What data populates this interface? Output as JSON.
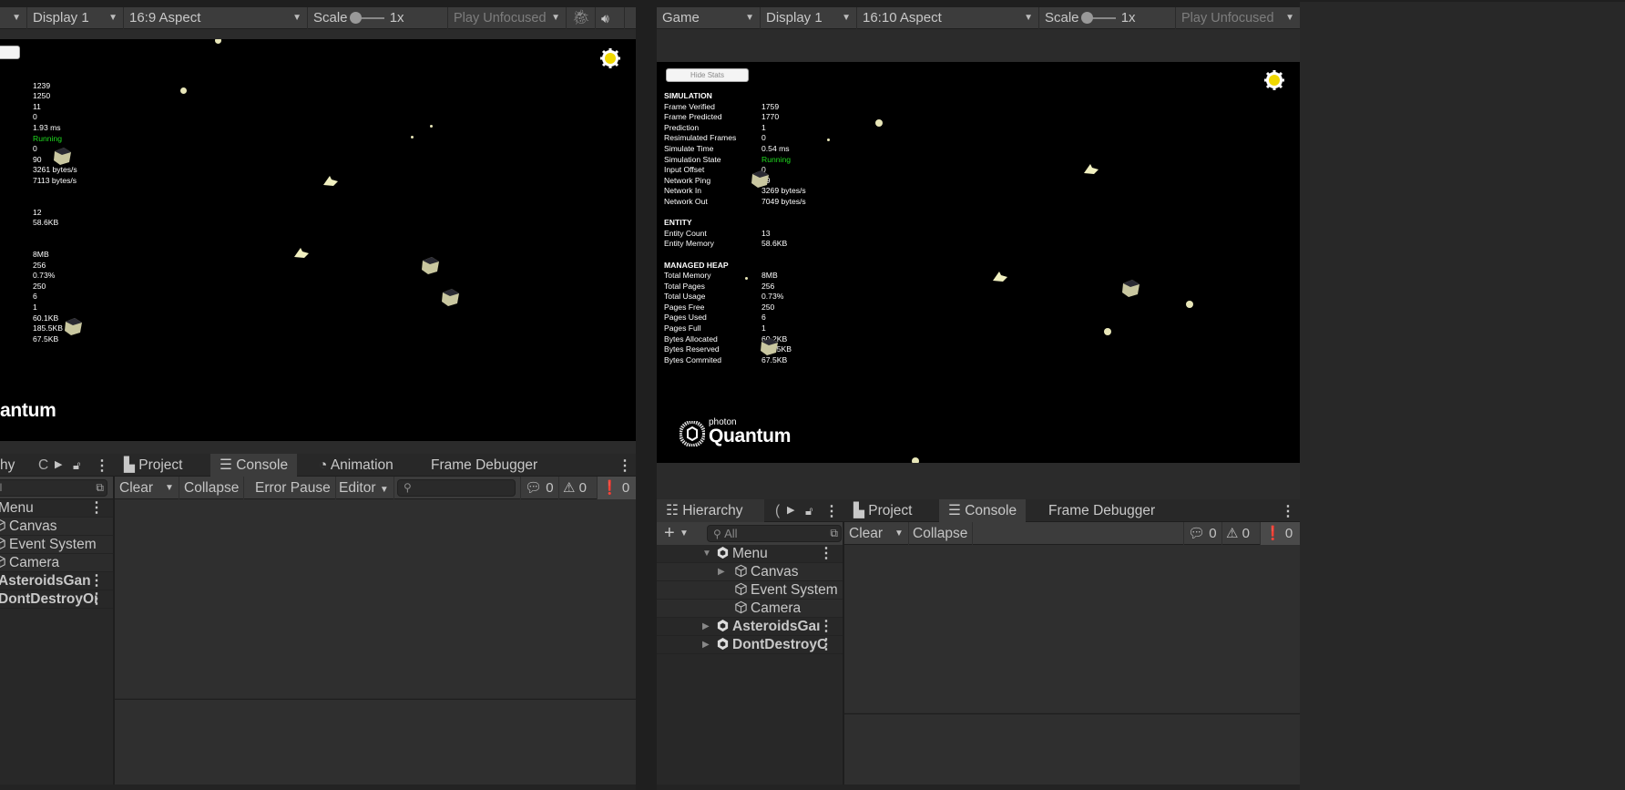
{
  "left_game": {
    "toolbar": {
      "display": "Display 1",
      "aspect": "16:9 Aspect",
      "scale_label": "Scale",
      "scale_value": "1x",
      "play_mode": "Play Unfocused",
      "icons": [
        "chevron-down-icon",
        "bug-icon",
        "audio-icon"
      ]
    },
    "stats": {
      "sections": [
        {
          "rows": [
            {
              "value": "1239"
            },
            {
              "value": "1250"
            },
            {
              "value": "11"
            },
            {
              "value": "0"
            },
            {
              "value": "1.93 ms"
            },
            {
              "value": "Running",
              "status": true
            },
            {
              "value": "0"
            },
            {
              "value": "90"
            },
            {
              "value": "3261 bytes/s"
            },
            {
              "value": "7113 bytes/s"
            }
          ]
        },
        {
          "rows": [
            {
              "value": "12"
            },
            {
              "value": "58.6KB"
            }
          ]
        },
        {
          "rows": [
            {
              "value": "8MB"
            },
            {
              "value": "256"
            },
            {
              "value": "0.73%"
            },
            {
              "value": "250"
            },
            {
              "value": "6"
            },
            {
              "value": "1"
            },
            {
              "value": "60.1KB"
            },
            {
              "value": "185.5KB"
            },
            {
              "value": "67.5KB"
            }
          ]
        }
      ]
    },
    "logo_text": "antum"
  },
  "right_game": {
    "toolbar": {
      "view": "Game",
      "display": "Display 1",
      "aspect": "16:10 Aspect",
      "scale_label": "Scale",
      "scale_value": "1x",
      "play_mode": "Play Unfocused"
    },
    "hide_stats": "Hide Stats",
    "stats": {
      "sections": [
        {
          "title": "SIMULATION",
          "rows": [
            {
              "label": "Frame Verified",
              "value": "1759"
            },
            {
              "label": "Frame Predicted",
              "value": "1770"
            },
            {
              "label": "Prediction",
              "value": "1"
            },
            {
              "label": "Resimulated Frames",
              "value": "0"
            },
            {
              "label": "Simulate Time",
              "value": "0.54 ms"
            },
            {
              "label": "Simulation State",
              "value": "Running",
              "status": true
            },
            {
              "label": "Input Offset",
              "value": "0"
            },
            {
              "label": "Network Ping",
              "value": "89"
            },
            {
              "label": "Network In",
              "value": "3269 bytes/s"
            },
            {
              "label": "Network Out",
              "value": "7049 bytes/s"
            }
          ]
        },
        {
          "title": "ENTITY",
          "rows": [
            {
              "label": "Entity Count",
              "value": "13"
            },
            {
              "label": "Entity Memory",
              "value": "58.6KB"
            }
          ]
        },
        {
          "title": "MANAGED HEAP",
          "rows": [
            {
              "label": "Total Memory",
              "value": "8MB"
            },
            {
              "label": "Total Pages",
              "value": "256"
            },
            {
              "label": "Total Usage",
              "value": "0.73%"
            },
            {
              "label": "Pages Free",
              "value": "250"
            },
            {
              "label": "Pages Used",
              "value": "6"
            },
            {
              "label": "Pages Full",
              "value": "1"
            },
            {
              "label": "Bytes Allocated",
              "value": "60.2KB"
            },
            {
              "label": "Bytes Reserved",
              "value": "185.5KB"
            },
            {
              "label": "Bytes Commited",
              "value": "67.5KB"
            }
          ]
        }
      ]
    },
    "logo": {
      "small": "photon",
      "big": "Quantum"
    }
  },
  "left_bottom": {
    "hierarchy_tab": "hy",
    "second_tab": "C",
    "search_value": "ll",
    "rows": [
      "Menu",
      "Canvas",
      "Event System",
      "Camera",
      "AsteroidsGan",
      "DontDestroyOı"
    ],
    "tabs": [
      "Project",
      "Console",
      "Animation",
      "Frame Debugger"
    ],
    "active_tab": "Console",
    "console": {
      "clear": "Clear",
      "collapse": "Collapse",
      "error_pause": "Error Pause",
      "editor": "Editor",
      "info_count": "0",
      "warning_count": "0",
      "error_count": "0"
    }
  },
  "right_bottom": {
    "hierarchy_tab": "Hierarchy",
    "second_tab": "(",
    "search_placeholder": "All",
    "rows": [
      "Menu",
      "Canvas",
      "Event System",
      "Camera",
      "AsteroidsGaı",
      "DontDestroyC"
    ],
    "tabs": [
      "Project",
      "Console",
      "Frame Debugger"
    ],
    "active_tab": "Console",
    "console": {
      "clear": "Clear",
      "collapse": "Collapse",
      "info_count": "0",
      "warning_count": "0",
      "error_count": "0"
    }
  },
  "colors": {
    "status_running": "#1fdc1f",
    "game_bg": "#000000",
    "editor_bg": "#282828",
    "toolbar_bg": "#3c3c3c"
  }
}
